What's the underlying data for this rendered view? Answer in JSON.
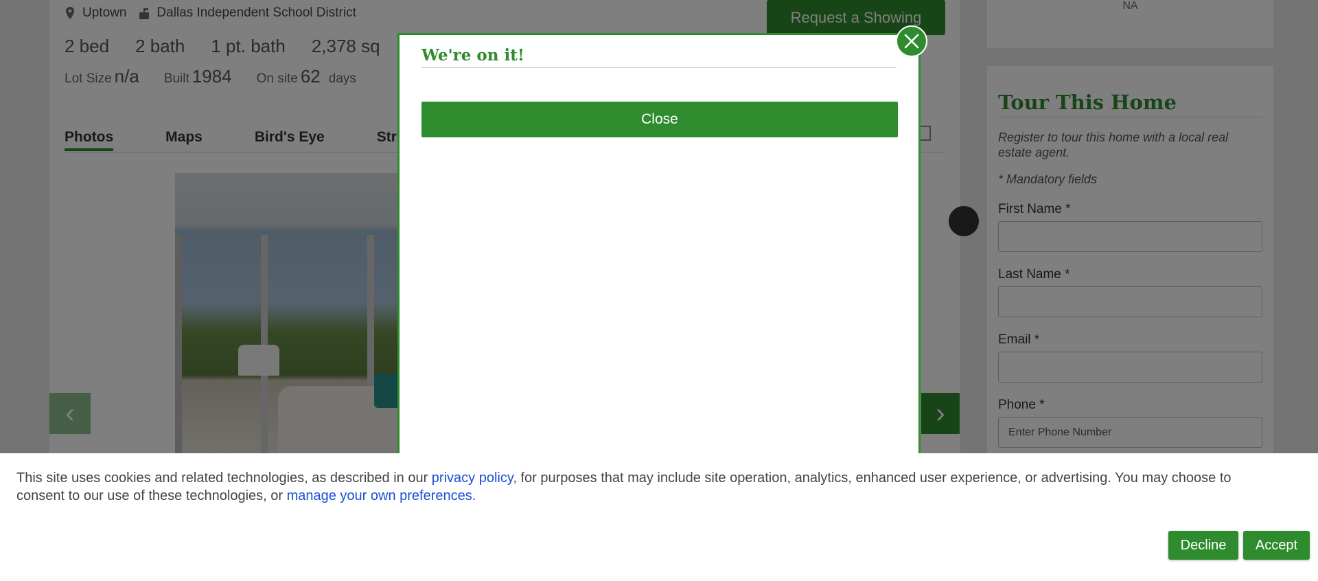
{
  "listing": {
    "neighborhood": "Uptown",
    "school_district": "Dallas Independent School District",
    "request_button": "Request a Showing",
    "beds": "2 bed",
    "baths": "2 bath",
    "partial_baths": "1 pt. bath",
    "sqft": "2,378 sq",
    "lot_size_label": "Lot Size",
    "lot_size_value": "n/a",
    "built_label": "Built",
    "built_value": "1984",
    "onsite_label": "On site",
    "onsite_value": "62",
    "onsite_unit": "days"
  },
  "media_tabs": [
    "Photos",
    "Maps",
    "Bird's Eye",
    "Str"
  ],
  "side_top": {
    "value": "NA"
  },
  "tour_form": {
    "title": "Tour This Home",
    "subtitle": "Register to tour this home with a local real estate agent.",
    "mandatory_note": "* Mandatory fields",
    "first_name_label": "First Name *",
    "last_name_label": "Last Name *",
    "email_label": "Email *",
    "phone_label": "Phone *",
    "phone_placeholder": "Enter Phone Number"
  },
  "modal": {
    "title": "We're on it!",
    "close_label": "Close"
  },
  "cookie_bar": {
    "text_before_link": "This site uses cookies and related technologies, as described in our ",
    "privacy_link": "privacy policy",
    "text_middle": ", for purposes that may include site operation, analytics, enhanced user experience, or advertising. You may choose to",
    "text_line2": "consent to our use of these technologies, or ",
    "preferences_link": "manage your own preferences.",
    "decline_label": "Decline",
    "accept_label": "Accept"
  },
  "colors": {
    "brand_green": "#2e8b2e",
    "link_blue": "#1a4fd6"
  },
  "icons": [
    "map-pin-icon",
    "school-icon",
    "mail-icon",
    "chevron-left-icon",
    "chevron-right-icon",
    "close-icon"
  ]
}
